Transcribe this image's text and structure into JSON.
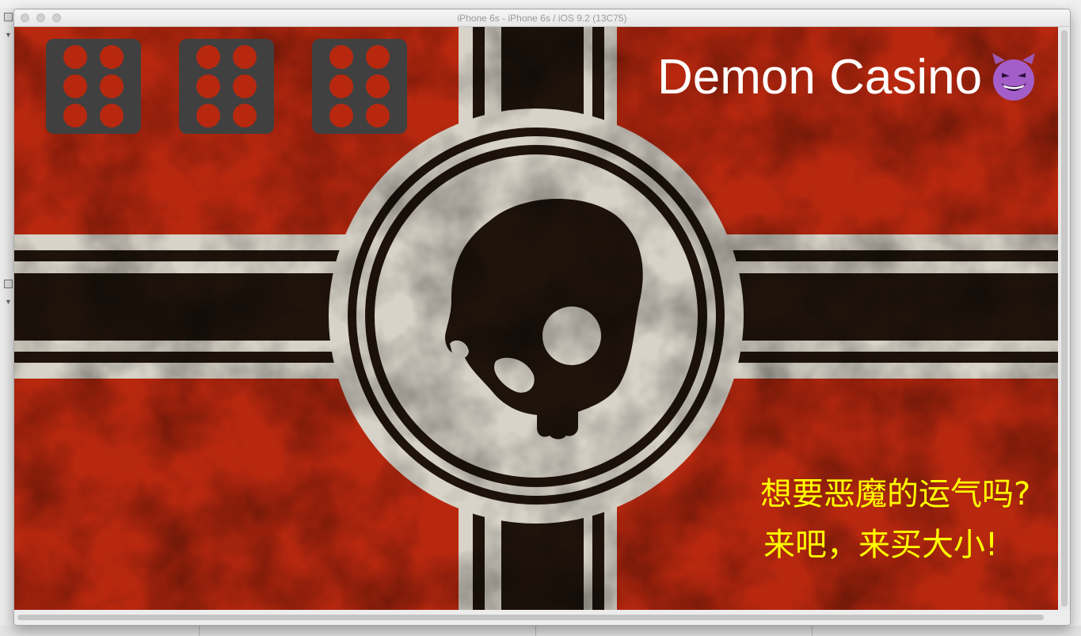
{
  "window": {
    "title": "iPhone 6s - iPhone 6s / iOS 9.2 (13C75)"
  },
  "app": {
    "title": "Demon Casino",
    "title_icon": "smiling-imp-emoji",
    "dice": [
      {
        "name": "die-1",
        "face": 6
      },
      {
        "name": "die-2",
        "face": 6
      },
      {
        "name": "die-3",
        "face": 6
      }
    ],
    "promo_line1": "想要恶魔的运气吗?",
    "promo_line2": "来吧，来买大小!",
    "background_icon": "skull-emblem",
    "colors": {
      "background_red": "#b8280f",
      "cross_dark": "#1f140c",
      "cross_light": "#d8d3c8",
      "dice": "#404040",
      "title": "#ffffff",
      "promo": "#ffff00"
    }
  }
}
